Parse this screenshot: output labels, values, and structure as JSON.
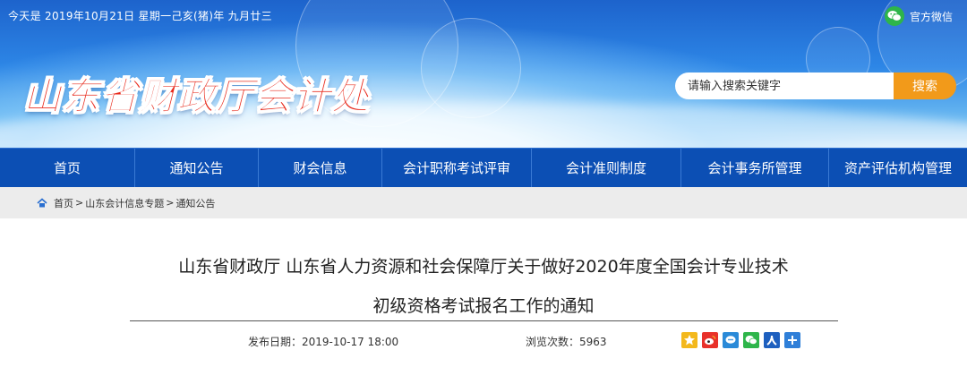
{
  "header": {
    "date_line": "今天是 2019年10月21日 星期一己亥(猪)年 九月廿三",
    "site_title": "山东省财政厅会计处",
    "wechat_label": "官方微信",
    "search_placeholder": "请输入搜索关键字",
    "search_button": "搜索"
  },
  "nav": {
    "items": [
      {
        "label": "首页"
      },
      {
        "label": "通知公告"
      },
      {
        "label": "财会信息"
      },
      {
        "label": "会计职称考试评审"
      },
      {
        "label": "会计准则制度"
      },
      {
        "label": "会计事务所管理"
      },
      {
        "label": "资产评估机构管理"
      }
    ]
  },
  "breadcrumb": {
    "items": [
      "首页",
      "山东会计信息专题",
      "通知公告"
    ],
    "separator": ">"
  },
  "article": {
    "title_line1": "山东省财政厅 山东省人力资源和社会保障厅关于做好2020年度全国会计专业技术",
    "title_line2": "初级资格考试报名工作的通知",
    "publish_label": "发布日期：2019-10-17 18:00",
    "views_label": "浏览次数：5963",
    "share_icons": [
      "qzone-icon",
      "weibo-icon",
      "tencent-weibo-icon",
      "wechat-icon",
      "renren-icon",
      "more-share-icon"
    ]
  },
  "colors": {
    "nav_bg": "#0c4fb4",
    "search_button": "#f29a1a",
    "title_red": "#e8281a",
    "wechat_green": "#2eb54a"
  }
}
